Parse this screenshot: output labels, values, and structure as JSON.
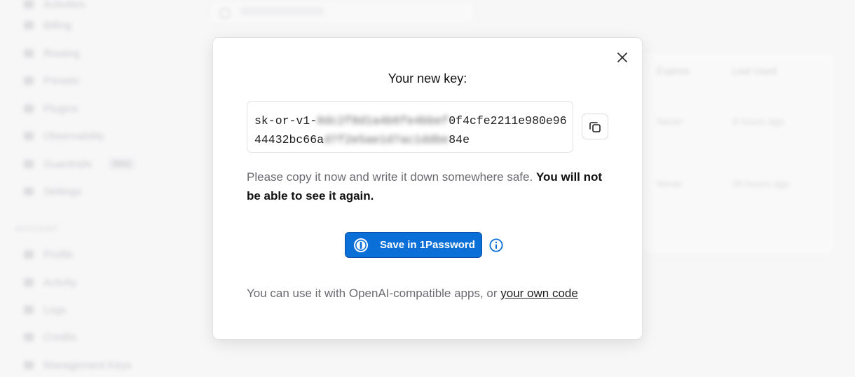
{
  "sidebar": {
    "items": [
      {
        "label": "Activities",
        "icon": "list-icon"
      },
      {
        "label": "Billing",
        "icon": "card-icon"
      },
      {
        "label": "Routing",
        "icon": "route-icon"
      },
      {
        "label": "Presets",
        "icon": "preset-icon"
      },
      {
        "label": "Plugins",
        "icon": "plugin-icon"
      },
      {
        "label": "Observability",
        "icon": "eye-icon"
      },
      {
        "label": "Guardrails",
        "icon": "shield-icon",
        "badge": "Beta"
      },
      {
        "label": "Settings",
        "icon": "gear-icon"
      }
    ],
    "section_label": "ACCOUNT",
    "account_items": [
      {
        "label": "Profile",
        "icon": "user-icon"
      },
      {
        "label": "Activity",
        "icon": "chart-icon"
      },
      {
        "label": "Logs",
        "icon": "log-icon"
      },
      {
        "label": "Credits",
        "icon": "coin-icon"
      },
      {
        "label": "Management Keys",
        "icon": "key-icon"
      }
    ]
  },
  "background_table": {
    "headers": [
      "Expires",
      "Last Used"
    ],
    "rows": [
      [
        "Never",
        "9 hours ago"
      ],
      [
        "Never",
        "20 hours ago"
      ]
    ]
  },
  "modal": {
    "title": "Your new key:",
    "key_line1_prefix": "sk-or-v1-",
    "key_line1_hidden": "0dc2f8d1a4b6fe4bbef",
    "key_line1_suffix": "0f4cfe2211e980e96",
    "key_line2_prefix": "44432bc66a",
    "key_line2_hidden": "d7f2e5ae1d7ac1ddbe",
    "key_line2_suffix": "84e",
    "warning_normal": "Please copy it now and write it down somewhere safe. ",
    "warning_bold": "You will not be able to see it again.",
    "onepassword_button": "Save in 1Password",
    "footer_text": "You can use it with OpenAI-compatible apps, or ",
    "footer_link": "your own code"
  },
  "colors": {
    "primary_button": "#0a6fd6",
    "info_icon": "#0a6fd6"
  }
}
